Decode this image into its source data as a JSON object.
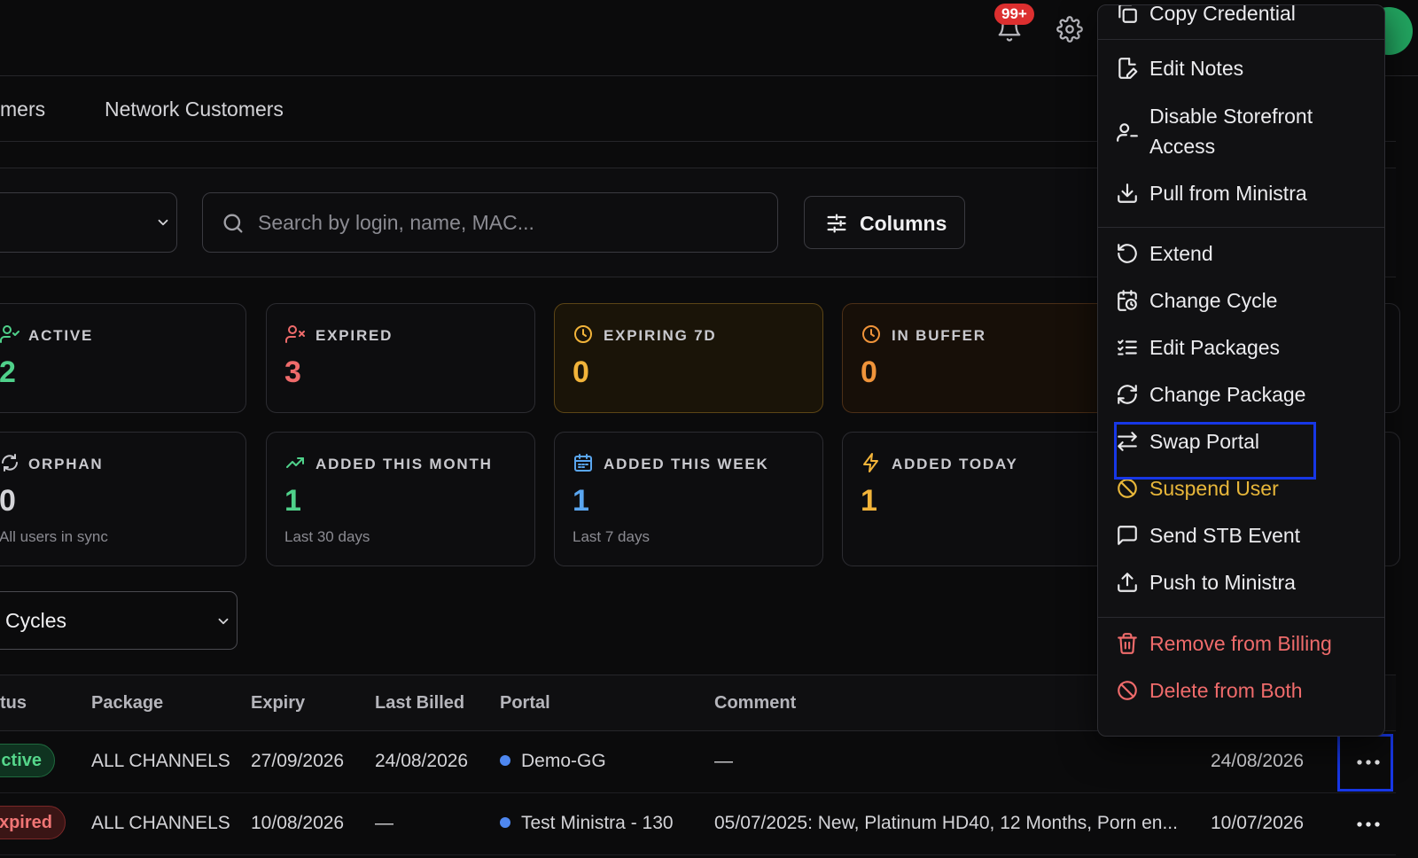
{
  "header": {
    "notifications_badge": "99+",
    "icons": {
      "bell": "bell-icon",
      "gear": "gear-icon"
    },
    "avatar_color": "#22a560"
  },
  "tabs": [
    {
      "label": "mers"
    },
    {
      "label": "Network Customers"
    }
  ],
  "toolbar": {
    "search_placeholder": "Search by login, name, MAC...",
    "columns_label": "Columns"
  },
  "stats": [
    {
      "key": "active",
      "title": "ACTIVE",
      "value": "2",
      "sub": "",
      "color": "#4fd18a",
      "icon": "user-check-icon"
    },
    {
      "key": "expired",
      "title": "EXPIRED",
      "value": "3",
      "sub": "",
      "color": "#ef6b6b",
      "icon": "user-x-icon"
    },
    {
      "key": "expiring",
      "title": "EXPIRING 7D",
      "value": "0",
      "sub": "",
      "color": "#f2b43a",
      "icon": "clock-icon"
    },
    {
      "key": "buffer",
      "title": "IN BUFFER",
      "value": "0",
      "sub": "",
      "color": "#f0943a",
      "icon": "clock-icon"
    },
    {
      "key": "orphan",
      "title": "ORPHAN",
      "value": "0",
      "sub": "All users in sync",
      "color": "#d4d4d8",
      "icon": "unlink-icon"
    },
    {
      "key": "month",
      "title": "ADDED THIS MONTH",
      "value": "1",
      "sub": "Last 30 days",
      "color": "#4fd18a",
      "icon": "trending-up-icon"
    },
    {
      "key": "week",
      "title": "ADDED THIS WEEK",
      "value": "1",
      "sub": "Last 7 days",
      "color": "#5aa6f0",
      "icon": "calendar-icon"
    },
    {
      "key": "today",
      "title": "ADDED TODAY",
      "value": "1",
      "sub": "",
      "color": "#f2b43a",
      "icon": "bolt-icon"
    }
  ],
  "cycles_filter": {
    "value": "Cycles"
  },
  "table": {
    "headers": {
      "status": "tus",
      "package": "Package",
      "expiry": "Expiry",
      "last_billed": "Last Billed",
      "portal": "Portal",
      "comment": "Comment"
    },
    "rows": [
      {
        "status": "ctive",
        "package": "ALL CHANNELS",
        "expiry": "27/09/2026",
        "last_billed": "24/08/2026",
        "portal": "Demo-GG",
        "comment": "—",
        "date": "24/08/2026"
      },
      {
        "status": "xpired",
        "package": "ALL CHANNELS",
        "expiry": "10/08/2026",
        "last_billed": "—",
        "portal": "Test Ministra - 130",
        "comment": "05/07/2025: New, Platinum HD40, 12 Months, Porn en...",
        "date": "10/07/2026"
      }
    ]
  },
  "menu": {
    "items": [
      {
        "label": "Copy Credential",
        "icon": "copy-icon"
      },
      {
        "label": "Edit Notes",
        "icon": "edit-notes-icon"
      },
      {
        "label": "Disable Storefront Access",
        "line1": "Disable Storefront",
        "line2": "Access",
        "icon": "user-minus-icon"
      },
      {
        "label": "Pull from Ministra",
        "icon": "download-icon"
      },
      {
        "label": "Extend",
        "icon": "rotate-ccw-icon"
      },
      {
        "label": "Change Cycle",
        "icon": "calendar-clock-icon"
      },
      {
        "label": "Edit Packages",
        "icon": "list-checks-icon"
      },
      {
        "label": "Change Package",
        "icon": "refresh-icon"
      },
      {
        "label": "Swap Portal",
        "icon": "swap-icon"
      },
      {
        "label": "Suspend User",
        "icon": "ban-icon"
      },
      {
        "label": "Send STB Event",
        "icon": "message-icon"
      },
      {
        "label": "Push to Ministra",
        "icon": "upload-icon"
      },
      {
        "label": "Remove from Billing",
        "icon": "trash-icon"
      },
      {
        "label": "Delete from Both",
        "icon": "ban-icon"
      }
    ]
  },
  "colors": {
    "accent_focus": "#1737e6",
    "danger": "#ef6b6b",
    "warning": "#e8b73a",
    "portal_dot": "#4e87f0"
  }
}
